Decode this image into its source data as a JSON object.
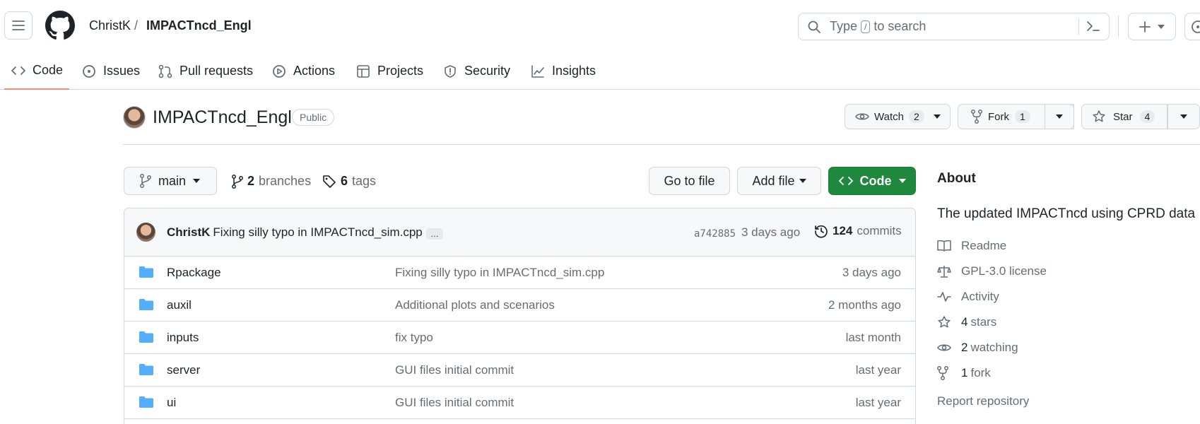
{
  "nav": {
    "owner": "ChristK",
    "separator": "/",
    "repo": "IMPACTncd_Engl",
    "search_placeholder": "Type",
    "search_key": "/",
    "search_suffix": "to search",
    "create_label": "+"
  },
  "tabs": [
    {
      "label": "Code",
      "icon": "code-icon"
    },
    {
      "label": "Issues",
      "icon": "issue-icon"
    },
    {
      "label": "Pull requests",
      "icon": "pull-request-icon"
    },
    {
      "label": "Actions",
      "icon": "play-icon"
    },
    {
      "label": "Projects",
      "icon": "table-icon"
    },
    {
      "label": "Security",
      "icon": "shield-icon"
    },
    {
      "label": "Insights",
      "icon": "graph-icon"
    }
  ],
  "repo_header": {
    "title": "IMPACTncd_Engl",
    "visibility": "Public",
    "watch": {
      "label": "Watch",
      "count": "2"
    },
    "fork": {
      "label": "Fork",
      "count": "1"
    },
    "star": {
      "label": "Star",
      "count": "4"
    }
  },
  "branch_bar": {
    "branch": "main",
    "branches_count": "2",
    "branches_label": "branches",
    "tags_count": "6",
    "tags_label": "tags",
    "go_to_file": "Go to file",
    "add_file": "Add file",
    "code": "Code"
  },
  "latest_commit": {
    "author": "ChristK",
    "message": "Fixing silly typo in IMPACTncd_sim.cpp",
    "ellipsis": "…",
    "sha": "a742885",
    "time": "3 days ago",
    "commits_count": "124",
    "commits_label": "commits"
  },
  "files": [
    {
      "name": "Rpackage",
      "message": "Fixing silly typo in IMPACTncd_sim.cpp",
      "time": "3 days ago"
    },
    {
      "name": "auxil",
      "message": "Additional plots and scenarios",
      "time": "2 months ago"
    },
    {
      "name": "inputs",
      "message": "fix typo",
      "time": "last month"
    },
    {
      "name": "server",
      "message": "GUI files initial commit",
      "time": "last year"
    },
    {
      "name": "ui",
      "message": "GUI files initial commit",
      "time": "last year"
    }
  ],
  "about": {
    "title": "About",
    "description": "The updated IMPACTncd using CPRD data",
    "readme": "Readme",
    "license": "GPL-3.0 license",
    "activity": "Activity",
    "stars_count": "4",
    "stars_label": "stars",
    "watching_count": "2",
    "watching_label": "watching",
    "forks_count": "1",
    "forks_label": "fork",
    "report": "Report repository"
  },
  "colors": {
    "accent_green": "#1f883d",
    "folder_blue": "#54aeff",
    "tab_underline": "#fd8c73"
  }
}
